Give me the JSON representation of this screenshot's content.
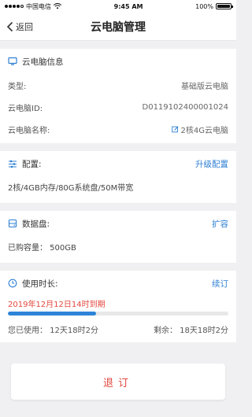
{
  "status": {
    "carrier": "中国电信",
    "time": "9:45 AM",
    "battery": "100%",
    "battery_level": 1.0
  },
  "nav": {
    "back_label": "返回",
    "title": "云电脑管理"
  },
  "info": {
    "section_title": "云电脑信息",
    "rows": [
      {
        "label": "类型:",
        "value": "基础版云电脑"
      },
      {
        "label": "云电脑ID:",
        "value": "D0119102400001024"
      },
      {
        "label": "云电脑名称:",
        "value": "2核4G云电脑"
      }
    ]
  },
  "config": {
    "section_title": "配置:",
    "action": "升级配置",
    "description": "2核/4GB内存/80G系统盘/50M带宽"
  },
  "disk": {
    "section_title": "数据盘:",
    "action": "扩容",
    "purchased": "已购容量：  500GB"
  },
  "usage": {
    "section_title": "使用时长:",
    "action": "续订",
    "expire": "2019年12月12日14时到期",
    "progress": 0.4,
    "used": "您已使用：  12天18时2分",
    "remaining": "剩余：  18天18时2分"
  },
  "cancel": {
    "label": "退订"
  },
  "colors": {
    "accent": "#2d7fd3",
    "danger": "#e2473d"
  }
}
